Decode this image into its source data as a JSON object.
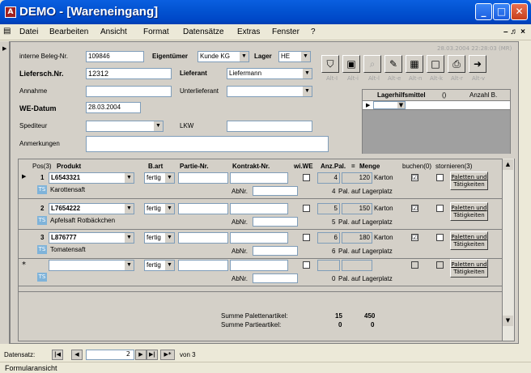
{
  "window": {
    "title": "DEMO - [Wareneingang]",
    "icon": "access-db-icon"
  },
  "menu": [
    "Datei",
    "Bearbeiten",
    "Ansicht",
    "Format",
    "Datensätze",
    "Extras",
    "Fenster",
    "?"
  ],
  "header": {
    "beleg_label": "interne Beleg-Nr.",
    "beleg_value": "109846",
    "eigentuemer_label": "Eigentümer",
    "eigentuemer_value": "Kunde KG",
    "lager_label": "Lager",
    "lager_value": "HE",
    "liefersch_label": "Liefersch.Nr.",
    "liefersch_value": "12312",
    "lieferant_label": "Lieferant",
    "lieferant_value": "Liefermann",
    "annahme_label": "Annahme",
    "annahme_value": "",
    "unterlieferant_label": "Unterlieferant",
    "unterlieferant_value": "",
    "wedatum_label": "WE-Datum",
    "wedatum_value": "28.03.2004",
    "spediteur_label": "Spediteur",
    "spediteur_value": "",
    "lkw_label": "LKW",
    "lkw_value": "",
    "anmerkungen_label": "Anmerkungen",
    "anmerkungen_value": "",
    "timestamp": "28.03.2004 22:28:03 (MR)"
  },
  "toolbar_labels": [
    "Alt-I",
    "Alt-i",
    "Alt-l",
    "Alt-e",
    "Alt-n",
    "Alt-k",
    "Alt-r",
    "Alt-v"
  ],
  "lagerhilfsmittel": {
    "title": "Lagerhilfsmittel",
    "count": "()",
    "col2": "Anzahl B."
  },
  "columns": {
    "pos": "Pos(3)",
    "produkt": "Produkt",
    "bart": "B.art",
    "partie": "Partie-Nr.",
    "kontrakt": "Kontrakt-Nr.",
    "wiwe": "wi.WE",
    "anzpal": "Anz.Pal.",
    "eq": "=",
    "menge": "Menge",
    "buchen": "buchen(0)",
    "stornieren": "stornieren(3)"
  },
  "rows": [
    {
      "pos": "1",
      "produkt": "L6543321",
      "desc": "Karottensaft",
      "bart": "fertig",
      "anz": "4",
      "menge": "120",
      "einheit": "Karton",
      "pal": "4",
      "palext": "Pal. auf Lagerplatz",
      "abnr": "AbNr.",
      "buchen": "☑",
      "btn1": "Paletten und",
      "btn2": "Tätigkeiten",
      "ts": "TS"
    },
    {
      "pos": "2",
      "produkt": "L7654222",
      "desc": "Apfelsaft Rotbäckchen",
      "bart": "fertig",
      "anz": "5",
      "menge": "150",
      "einheit": "Karton",
      "pal": "5",
      "palext": "Pal. auf Lagerplatz",
      "abnr": "AbNr.",
      "buchen": "☑",
      "btn1": "Paletten und",
      "btn2": "Tätigkeiten",
      "ts": "TS"
    },
    {
      "pos": "3",
      "produkt": "L876777",
      "desc": "Tomatensaft",
      "bart": "fertig",
      "anz": "6",
      "menge": "180",
      "einheit": "Karton",
      "pal": "6",
      "palext": "Pal. auf Lagerplatz",
      "abnr": "AbNr.",
      "buchen": "☑",
      "btn1": "Paletten und",
      "btn2": "Tätigkeiten",
      "ts": "TS"
    },
    {
      "pos": "*",
      "produkt": "",
      "desc": "",
      "bart": "fertig",
      "anz": "",
      "menge": "",
      "einheit": "",
      "pal": "0",
      "palext": "Pal. auf Lagerplatz",
      "abnr": "AbNr.",
      "buchen": "",
      "btn1": "Paletten und",
      "btn2": "Tätigkeiten",
      "ts": "TS"
    }
  ],
  "summary": {
    "pal_label": "Summe Palettenartikel:",
    "pal_anz": "15",
    "pal_menge": "450",
    "partie_label": "Summe Partieartikel:",
    "partie_anz": "0",
    "partie_menge": "0"
  },
  "nav": {
    "label": "Datensatz:",
    "current": "2",
    "total": "von 3"
  },
  "status": "Formularansicht"
}
